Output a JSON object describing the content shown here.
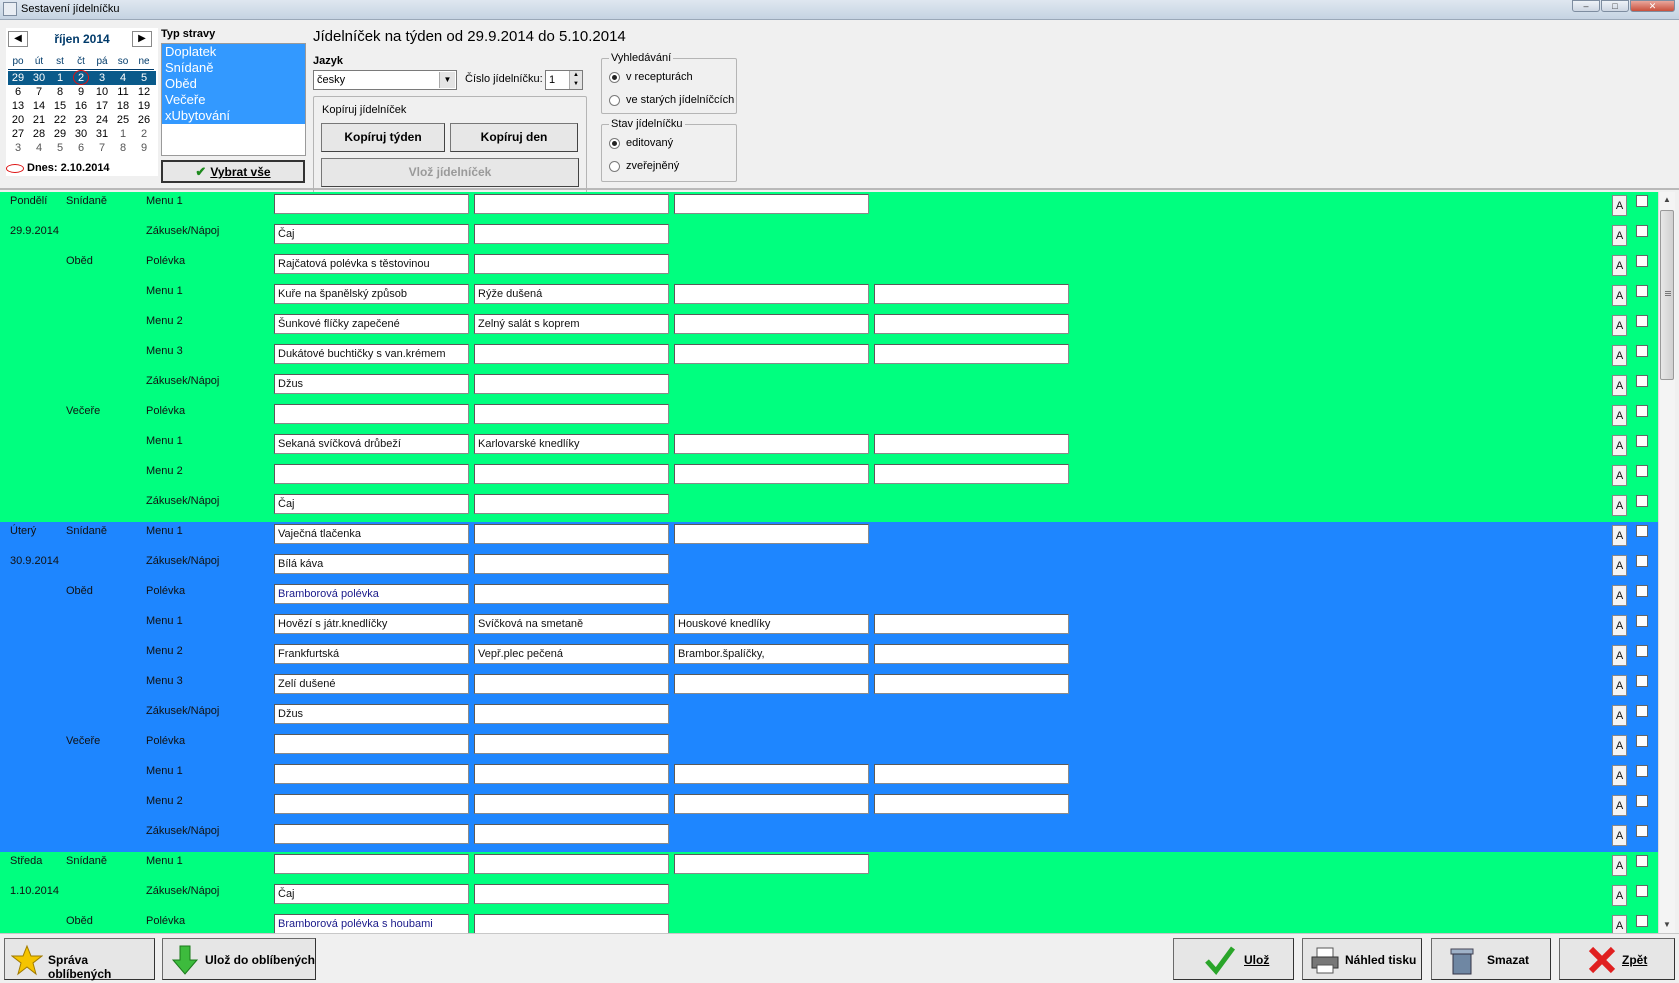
{
  "window": {
    "title": "Sestavení jídelníčku"
  },
  "calendar": {
    "month": "říjen 2014",
    "weekdays": [
      "po",
      "út",
      "st",
      "čt",
      "pá",
      "so",
      "ne"
    ],
    "weeks": [
      [
        "29",
        "30",
        "1",
        "2",
        "3",
        "4",
        "5"
      ],
      [
        "6",
        "7",
        "8",
        "9",
        "10",
        "11",
        "12"
      ],
      [
        "13",
        "14",
        "15",
        "16",
        "17",
        "18",
        "19"
      ],
      [
        "20",
        "21",
        "22",
        "23",
        "24",
        "25",
        "26"
      ],
      [
        "27",
        "28",
        "29",
        "30",
        "31",
        "1",
        "2"
      ],
      [
        "3",
        "4",
        "5",
        "6",
        "7",
        "8",
        "9"
      ]
    ],
    "today": "Dnes: 2.10.2014"
  },
  "typ_stravy": {
    "label": "Typ stravy",
    "items": [
      "Doplatek",
      "Snídaně",
      "Oběd",
      "Večeře",
      "xUbytování"
    ],
    "select_all": "Vybrat vše"
  },
  "header": {
    "title": "Jídelníček na týden od 29.9.2014 do 5.10.2014",
    "jazyk_label": "Jazyk",
    "jazyk_value": "česky",
    "cislo_label": "Číslo jídelníčku:",
    "cislo_value": "1",
    "kopiruj_label": "Kopíruj jídelníček",
    "kopiruj_tyden": "Kopíruj týden",
    "kopiruj_den": "Kopíruj den",
    "vloz": "Vlož jídelníček",
    "vyhledavani_label": "Vyhledávání",
    "vyhledavani_options": [
      "v recepturách",
      "ve starých jídelníčcích"
    ],
    "stav_label": "Stav jídelníčku",
    "stav_options": [
      "editovaný",
      "zveřejněný"
    ]
  },
  "rows": [
    {
      "day": "Pondělí",
      "meal": "Snídaně",
      "course": "Menu 1",
      "cells": [
        "",
        "",
        ""
      ],
      "color": "green"
    },
    {
      "day": "29.9.2014",
      "meal": "",
      "course": "Zákusek/Nápoj",
      "cells": [
        "Čaj",
        ""
      ],
      "color": "green"
    },
    {
      "day": "",
      "meal": "Oběd",
      "course": "Polévka",
      "cells": [
        "Rajčatová polévka s těstovinou",
        ""
      ],
      "color": "green"
    },
    {
      "day": "",
      "meal": "",
      "course": "Menu 1",
      "cells": [
        "Kuře na španělský způsob",
        "Rýže dušená",
        "",
        ""
      ],
      "color": "green"
    },
    {
      "day": "",
      "meal": "",
      "course": "Menu 2",
      "cells": [
        "Šunkové flíčky zapečené",
        "Zelný salát s koprem",
        "",
        ""
      ],
      "color": "green"
    },
    {
      "day": "",
      "meal": "",
      "course": "Menu 3",
      "cells": [
        "Dukátové buchtičky s van.krémem",
        "",
        "",
        ""
      ],
      "color": "green"
    },
    {
      "day": "",
      "meal": "",
      "course": "Zákusek/Nápoj",
      "cells": [
        "Džus",
        ""
      ],
      "color": "green"
    },
    {
      "day": "",
      "meal": "Večeře",
      "course": "Polévka",
      "cells": [
        "",
        ""
      ],
      "color": "green"
    },
    {
      "day": "",
      "meal": "",
      "course": "Menu 1",
      "cells": [
        "Sekaná svíčková drůbeží",
        "Karlovarské knedlíky",
        "",
        ""
      ],
      "color": "green"
    },
    {
      "day": "",
      "meal": "",
      "course": "Menu 2",
      "cells": [
        "",
        "",
        "",
        ""
      ],
      "color": "green"
    },
    {
      "day": "",
      "meal": "",
      "course": "Zákusek/Nápoj",
      "cells": [
        "Čaj",
        ""
      ],
      "color": "green"
    },
    {
      "day": "Úterý",
      "meal": "Snídaně",
      "course": "Menu 1",
      "cells": [
        "Vaječná tlačenka",
        "",
        ""
      ],
      "color": "blue"
    },
    {
      "day": "30.9.2014",
      "meal": "",
      "course": "Zákusek/Nápoj",
      "cells": [
        "Bílá káva",
        ""
      ],
      "color": "blue"
    },
    {
      "day": "",
      "meal": "Oběd",
      "course": "Polévka",
      "cells": [
        "Bramborová polévka",
        ""
      ],
      "color": "blue",
      "dark": true
    },
    {
      "day": "",
      "meal": "",
      "course": "Menu 1",
      "cells": [
        "Hovězí s játr.knedlíčky",
        "Svíčková na smetaně",
        "Houskové knedlíky",
        ""
      ],
      "color": "blue"
    },
    {
      "day": "",
      "meal": "",
      "course": "Menu 2",
      "cells": [
        "Frankfurtská",
        "Vepř.plec pečená",
        "Brambor.špalíčky,",
        ""
      ],
      "color": "blue"
    },
    {
      "day": "",
      "meal": "",
      "course": "Menu 3",
      "cells": [
        "Zelí dušené",
        "",
        "",
        ""
      ],
      "color": "blue"
    },
    {
      "day": "",
      "meal": "",
      "course": "Zákusek/Nápoj",
      "cells": [
        "Džus",
        ""
      ],
      "color": "blue"
    },
    {
      "day": "",
      "meal": "Večeře",
      "course": "Polévka",
      "cells": [
        "",
        ""
      ],
      "color": "blue"
    },
    {
      "day": "",
      "meal": "",
      "course": "Menu 1",
      "cells": [
        "",
        "",
        "",
        ""
      ],
      "color": "blue"
    },
    {
      "day": "",
      "meal": "",
      "course": "Menu 2",
      "cells": [
        "",
        "",
        "",
        ""
      ],
      "color": "blue"
    },
    {
      "day": "",
      "meal": "",
      "course": "Zákusek/Nápoj",
      "cells": [
        "",
        ""
      ],
      "color": "blue"
    },
    {
      "day": "Středa",
      "meal": "Snídaně",
      "course": "Menu 1",
      "cells": [
        "",
        "",
        ""
      ],
      "color": "green"
    },
    {
      "day": "1.10.2014",
      "meal": "",
      "course": "Zákusek/Nápoj",
      "cells": [
        "Čaj",
        ""
      ],
      "color": "green"
    },
    {
      "day": "",
      "meal": "Oběd",
      "course": "Polévka",
      "cells": [
        "Bramborová polévka s houbami",
        ""
      ],
      "color": "green",
      "dark": true
    }
  ],
  "row_button_label": "A",
  "footer": {
    "sprava": "Správa oblíbených",
    "uloz_obl": "Ulož do oblíbených",
    "uloz": "Ulož",
    "nahled": "Náhled tisku",
    "smazat": "Smazat",
    "zpet": "Zpět"
  },
  "colors": {
    "green": "#00ff7f",
    "blue": "#1e86ff",
    "list_select": "#3399ff"
  }
}
